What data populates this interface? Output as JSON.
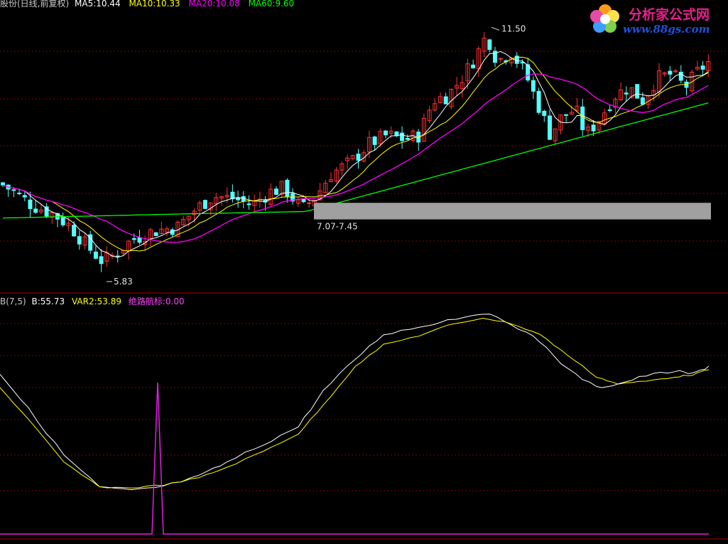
{
  "main_header": {
    "title": "股份(日线,前复权)",
    "ma5": "MA5:10.44",
    "ma10": "MA10:10.33",
    "ma20": "MA20:10.08",
    "ma60": "MA60:9.60"
  },
  "sub_header": {
    "indicator": "B(7,5)",
    "b": "B:55.73",
    "var2": "VAR2:53.89",
    "signal_name": "绝路航标",
    "signal_value": ":0.00"
  },
  "annotations": {
    "high": "11.50",
    "low": "5.83",
    "zone": "7.07-7.45"
  },
  "logo": {
    "title": "分析家公式网",
    "url": "www.88gs.com"
  },
  "colors": {
    "background": "#000000",
    "ma5": "#ffffff",
    "ma10": "#ffff00",
    "ma20": "#ff00ff",
    "ma60": "#00ff00",
    "candle_up": "#ff3232",
    "candle_down": "#54ffff",
    "grid": "#880000",
    "zone_box": "#a0a0a0",
    "signal": "#e020e0"
  },
  "chart_data": {
    "type": "line",
    "title": "股份(日线,前复权)",
    "y_range_visible": [
      5.5,
      11.8
    ],
    "series": [
      {
        "name": "MA5",
        "last": 10.44
      },
      {
        "name": "MA10",
        "last": 10.33
      },
      {
        "name": "MA20",
        "last": 10.08
      },
      {
        "name": "MA60",
        "last": 9.6
      }
    ],
    "key_prices": {
      "high": 11.5,
      "low": 5.83,
      "zone_low": 7.07,
      "zone_high": 7.45
    },
    "indicator": {
      "name": "B(7,5)",
      "series": [
        {
          "name": "B",
          "last": 55.73
        },
        {
          "name": "VAR2",
          "last": 53.89
        },
        {
          "name": "绝路航标",
          "last": 0.0
        }
      ]
    }
  }
}
